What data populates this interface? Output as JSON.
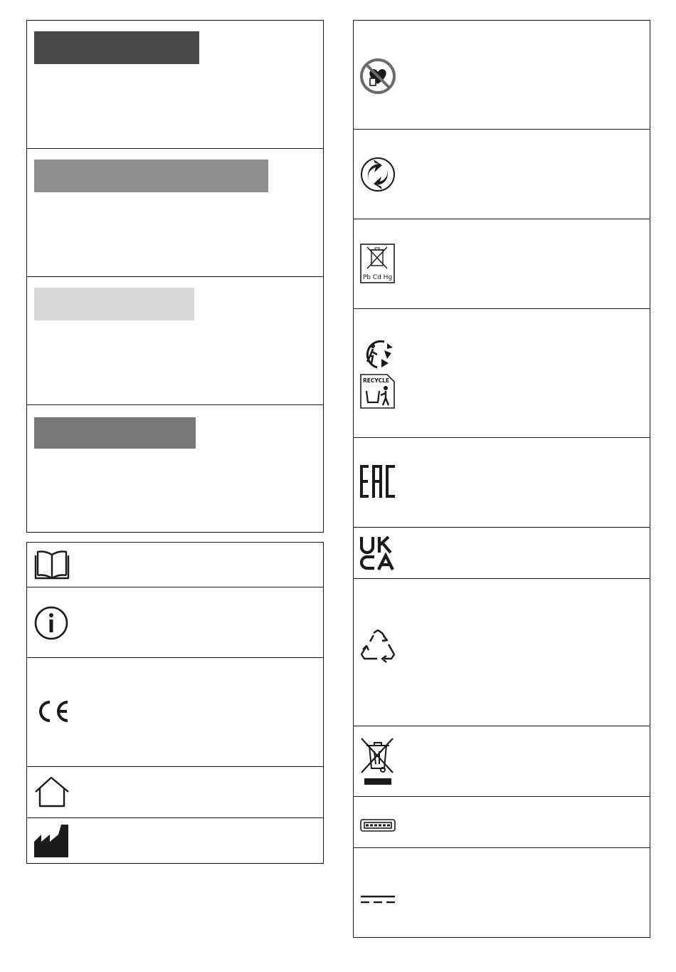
{
  "colors": {
    "danger": "#48484a",
    "warning": "#8e8e90",
    "caution": "#d8d8d8",
    "notice": "#77797b",
    "line": "#1a1a1a"
  },
  "hazard_levels": [
    {
      "name": "danger-level-bar",
      "color": "#48484a"
    },
    {
      "name": "warning-level-bar",
      "color": "#8e8e90"
    },
    {
      "name": "caution-level-bar",
      "color": "#d8d8d8"
    },
    {
      "name": "notice-level-bar",
      "color": "#77797b"
    }
  ],
  "left_symbols": [
    "read-manual-icon",
    "info-icon",
    "ce-mark-icon",
    "indoor-use-icon",
    "manufacturer-icon"
  ],
  "right_symbols": {
    "pacemaker": "no-pacemaker-icon",
    "green_dot": "green-dot-icon",
    "battery": {
      "icon": "battery-disposal-icon",
      "label": "Pb Cd Hg"
    },
    "triman": "triman-icon",
    "recycle_box": {
      "icon": "recycle-bin-icon",
      "label": "RECYCLE"
    },
    "eac": {
      "icon": "eac-mark-icon",
      "label": "EAC"
    },
    "ukca": {
      "icon": "ukca-mark-icon",
      "line1": "UK",
      "line2": "CA"
    },
    "recycling": "recycling-triangle-icon",
    "weee": "weee-bin-icon",
    "usb": "usb-port-icon",
    "dc": "direct-current-icon"
  }
}
